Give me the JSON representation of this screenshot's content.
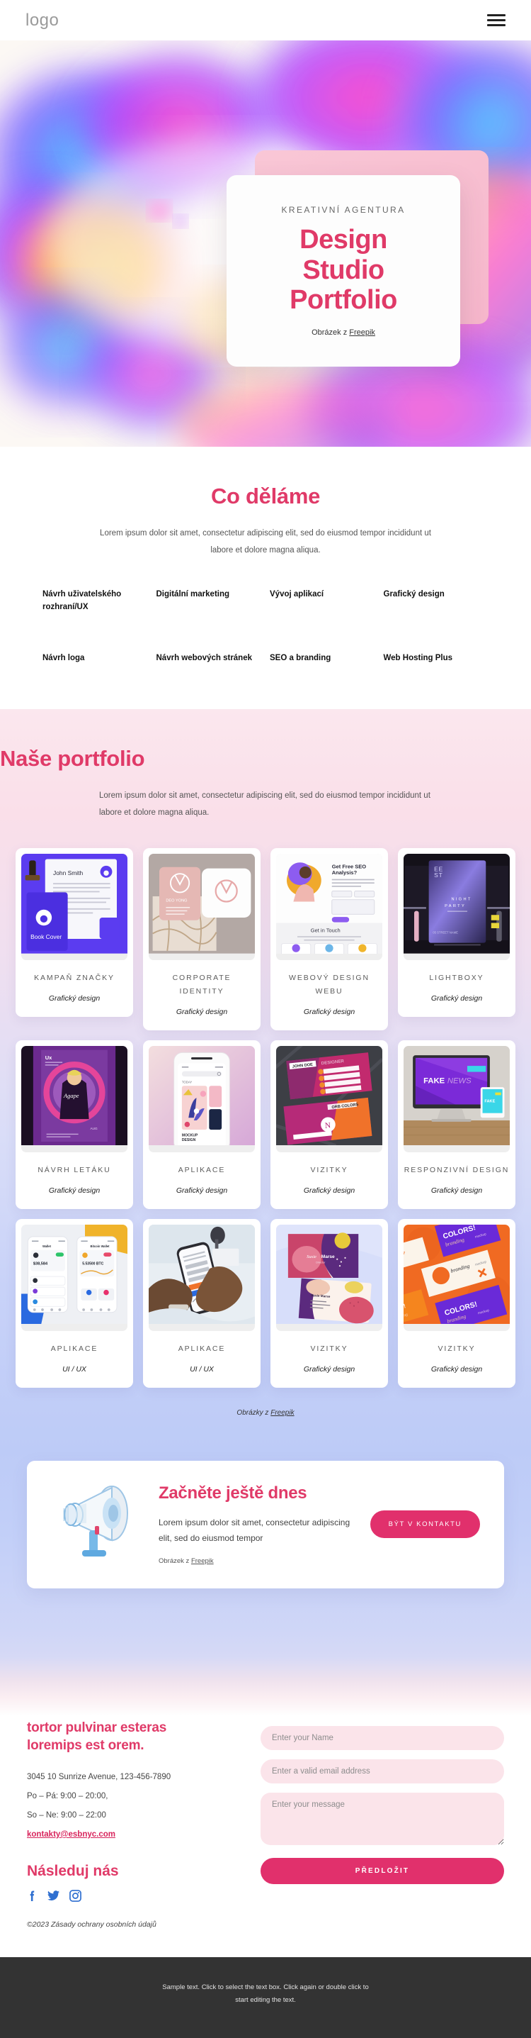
{
  "header": {
    "logo": "logo",
    "menu_icon": "hamburger-icon"
  },
  "hero": {
    "eyebrow": "KREATIVNÍ AGENTURA",
    "title_line1": "Design",
    "title_line2": "Studio",
    "title_line3": "Portfolio",
    "credit_prefix": "Obrázek z ",
    "credit_link": "Freepik"
  },
  "services": {
    "title": "Co děláme",
    "subtitle": "Lorem ipsum dolor sit amet, consectetur adipiscing elit, sed do eiusmod tempor incididunt ut labore et dolore magna aliqua.",
    "items": [
      "Návrh uživatelského rozhraní/UX",
      "Digitální marketing",
      "Vývoj aplikací",
      "Grafický design",
      "Návrh loga",
      "Návrh webových stránek",
      "SEO a branding",
      "Web Hosting Plus"
    ]
  },
  "portfolio": {
    "title": "Naše portfolio",
    "subtitle": "Lorem ipsum dolor sit amet, consectetur adipiscing elit, sed do eiusmod tempor incididunt ut labore et dolore magna aliqua.",
    "credit_prefix": "Obrázky z ",
    "credit_link": "Freepik",
    "items": [
      {
        "name": "KAMPAŇ ZNAČKY",
        "category": "Grafický design",
        "thumb": "brand-stationery-thumb"
      },
      {
        "name": "CORPORATE IDENTITY",
        "category": "Grafický design",
        "thumb": "corporate-identity-thumb"
      },
      {
        "name": "WEBOVÝ DESIGN WEBU",
        "category": "Grafický design",
        "thumb": "seo-landing-page-thumb"
      },
      {
        "name": "LIGHTBOXY",
        "category": "Grafický design",
        "thumb": "lightbox-billboard-thumb"
      },
      {
        "name": "NÁVRH LETÁKU",
        "category": "Grafický design",
        "thumb": "flyer-poster-thumb"
      },
      {
        "name": "APLIKACE",
        "category": "Grafický design",
        "thumb": "phone-mockup-thumb"
      },
      {
        "name": "VIZITKY",
        "category": "Grafický design",
        "thumb": "business-cards-thumb"
      },
      {
        "name": "RESPONZIVNÍ DESIGN",
        "category": "Grafický design",
        "thumb": "imac-fakenews-thumb"
      },
      {
        "name": "APLIKACE",
        "category": "UI / UX",
        "thumb": "wallet-app-screens-thumb"
      },
      {
        "name": "APLIKACE",
        "category": "UI / UX",
        "thumb": "hands-phone-thumb"
      },
      {
        "name": "VIZITKY",
        "category": "Grafický design",
        "thumb": "abstract-cards-thumb"
      },
      {
        "name": "VIZITKY",
        "category": "Grafický design",
        "thumb": "colors-branding-thumb"
      }
    ]
  },
  "cta": {
    "title": "Začněte ještě dnes",
    "text": "Lorem ipsum dolor sit amet, consectetur adipiscing elit, sed do eiusmod tempor",
    "credit_prefix": "Obrázek z ",
    "credit_link": "Freepik",
    "button": "BÝT V KONTAKTU",
    "illustration": "megaphone-icon"
  },
  "contact": {
    "heading_line1": "tortor pulvinar esteras",
    "heading_line2": "loremips est orem.",
    "address": "3045 10 Sunrize Avenue, 123-456-7890",
    "hours_weekday": "Po – Pá: 9:00 – 20:00,",
    "hours_weekend": "So – Ne: 9:00 – 22:00",
    "email": "kontakty@esbnyc.com",
    "follow_title": "Následuj nás",
    "socials": [
      "facebook-icon",
      "twitter-icon",
      "instagram-icon"
    ],
    "form": {
      "name_placeholder": "Enter your Name",
      "name_value": "",
      "email_placeholder": "Enter a valid email address",
      "email_value": "",
      "message_placeholder": "Enter your message",
      "message_value": "",
      "submit_label": "PŘEDLOŽIT"
    },
    "copyright": "©2023 Zásady ochrany osobních údajů"
  },
  "dark_footer": {
    "text": "Sample text. Click to select the text box. Click again or double click to start editing the text."
  },
  "colors": {
    "accent": "#e03a68",
    "accent_button": "#e1306c",
    "link_blue": "#2f6fd0",
    "dark_footer_bg": "#333333"
  }
}
